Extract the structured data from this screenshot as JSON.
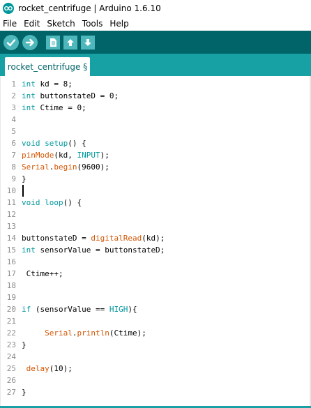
{
  "window": {
    "title": "rocket_centrifuge | Arduino 1.6.10"
  },
  "menu": [
    "File",
    "Edit",
    "Sketch",
    "Tools",
    "Help"
  ],
  "toolbar": {
    "icons": [
      "verify-icon",
      "upload-icon",
      "new-icon",
      "open-icon",
      "save-icon"
    ]
  },
  "tab": {
    "label": "rocket_centrifuge §"
  },
  "editor": {
    "cursor_line": 10,
    "lines": [
      {
        "n": "1",
        "tokens": [
          [
            "kw",
            "int"
          ],
          [
            "t",
            " kd = 8;"
          ]
        ]
      },
      {
        "n": "2",
        "tokens": [
          [
            "kw",
            "int"
          ],
          [
            "t",
            " buttonstateD = 0;"
          ]
        ]
      },
      {
        "n": "3",
        "tokens": [
          [
            "kw",
            "int"
          ],
          [
            "t",
            " Ctime = 0;"
          ]
        ]
      },
      {
        "n": "4",
        "tokens": []
      },
      {
        "n": "5",
        "tokens": []
      },
      {
        "n": "6",
        "tokens": [
          [
            "kw",
            "void"
          ],
          [
            "t",
            " "
          ],
          [
            "kw",
            "setup"
          ],
          [
            "t",
            "() {"
          ]
        ]
      },
      {
        "n": "7",
        "tokens": [
          [
            "fn",
            "pinMode"
          ],
          [
            "t",
            "(kd, "
          ],
          [
            "kw",
            "INPUT"
          ],
          [
            "t",
            ");"
          ]
        ]
      },
      {
        "n": "8",
        "tokens": [
          [
            "fn",
            "Serial"
          ],
          [
            "t",
            "."
          ],
          [
            "fn",
            "begin"
          ],
          [
            "t",
            "(9600);"
          ]
        ]
      },
      {
        "n": "9",
        "tokens": [
          [
            "t",
            "}"
          ]
        ]
      },
      {
        "n": "10",
        "tokens": []
      },
      {
        "n": "11",
        "tokens": [
          [
            "kw",
            "void"
          ],
          [
            "t",
            " "
          ],
          [
            "kw",
            "loop"
          ],
          [
            "t",
            "() {"
          ]
        ]
      },
      {
        "n": "12",
        "tokens": []
      },
      {
        "n": "13",
        "tokens": []
      },
      {
        "n": "14",
        "tokens": [
          [
            "t",
            "buttonstateD = "
          ],
          [
            "fn",
            "digitalRead"
          ],
          [
            "t",
            "(kd);"
          ]
        ]
      },
      {
        "n": "15",
        "tokens": [
          [
            "kw",
            "int"
          ],
          [
            "t",
            " sensorValue = buttonstateD;"
          ]
        ]
      },
      {
        "n": "16",
        "tokens": []
      },
      {
        "n": "17",
        "tokens": [
          [
            "t",
            " Ctime++;"
          ]
        ]
      },
      {
        "n": "18",
        "tokens": []
      },
      {
        "n": "19",
        "tokens": []
      },
      {
        "n": "20",
        "tokens": [
          [
            "kw",
            "if"
          ],
          [
            "t",
            " (sensorValue == "
          ],
          [
            "kw",
            "HIGH"
          ],
          [
            "t",
            "){"
          ]
        ]
      },
      {
        "n": "21",
        "tokens": []
      },
      {
        "n": "22",
        "tokens": [
          [
            "t",
            "     "
          ],
          [
            "fn",
            "Serial"
          ],
          [
            "t",
            "."
          ],
          [
            "fn",
            "println"
          ],
          [
            "t",
            "(Ctime);"
          ]
        ]
      },
      {
        "n": "23",
        "tokens": [
          [
            "t",
            "}"
          ]
        ]
      },
      {
        "n": "24",
        "tokens": []
      },
      {
        "n": "25",
        "tokens": [
          [
            "t",
            " "
          ],
          [
            "fn",
            "delay"
          ],
          [
            "t",
            "(10);"
          ]
        ]
      },
      {
        "n": "26",
        "tokens": []
      },
      {
        "n": "27",
        "tokens": [
          [
            "t",
            "}"
          ]
        ]
      }
    ]
  },
  "colors": {
    "toolbar_bg": "#006468",
    "tab_bar_bg": "#17a1a5",
    "button_bg": "#4db7bb",
    "keyword": "#00979c",
    "function": "#d35400"
  }
}
